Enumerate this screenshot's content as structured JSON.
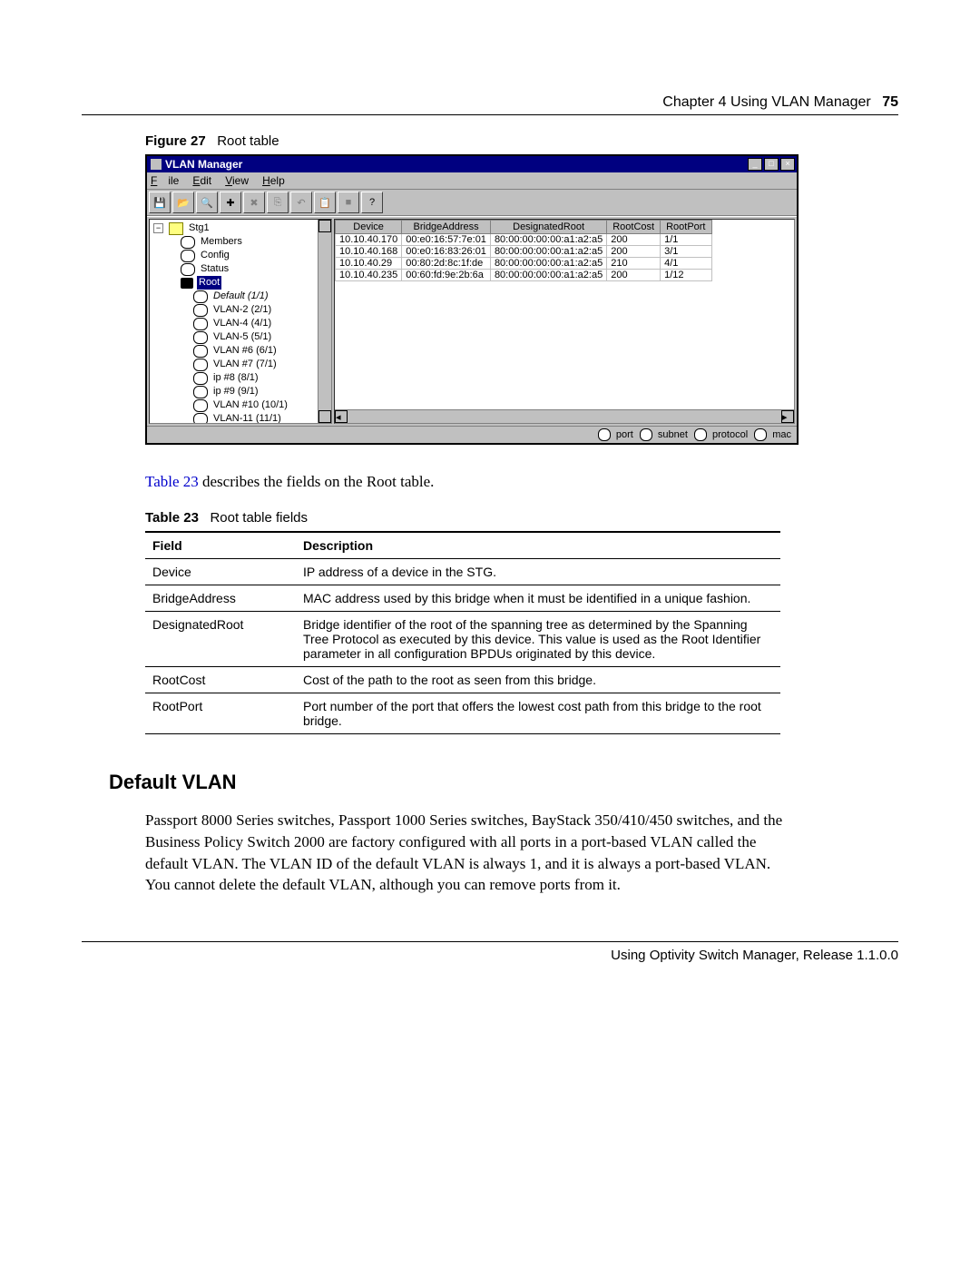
{
  "header": {
    "chapterText": "Chapter 4  Using VLAN Manager",
    "pageNumber": "75"
  },
  "figureCaption": {
    "label": "Figure 27",
    "title": "Root table"
  },
  "window": {
    "title": "VLAN Manager",
    "menus": {
      "file": "File",
      "edit": "Edit",
      "view": "View",
      "help": "Help"
    },
    "toolbarIcons": [
      "save",
      "print",
      "zoom",
      "add",
      "delete",
      "copy",
      "undo",
      "paste",
      "stop",
      "help"
    ],
    "tree": {
      "root": "Stg1",
      "nodes": [
        {
          "label": "Members",
          "glyph": "node",
          "indent": 30
        },
        {
          "label": "Config",
          "glyph": "node",
          "indent": 30
        },
        {
          "label": "Status",
          "glyph": "node",
          "indent": 30
        },
        {
          "label": "Root",
          "glyph": "root",
          "indent": 30,
          "selected": true
        },
        {
          "label": "Default (1/1)",
          "glyph": "node",
          "indent": 44,
          "italic": true
        },
        {
          "label": "VLAN-2 (2/1)",
          "glyph": "node",
          "indent": 44
        },
        {
          "label": "VLAN-4 (4/1)",
          "glyph": "node",
          "indent": 44
        },
        {
          "label": "VLAN-5 (5/1)",
          "glyph": "node",
          "indent": 44
        },
        {
          "label": "VLAN #6 (6/1)",
          "glyph": "node",
          "indent": 44
        },
        {
          "label": "VLAN #7 (7/1)",
          "glyph": "node",
          "indent": 44
        },
        {
          "label": "ip #8 (8/1)",
          "glyph": "node",
          "indent": 44
        },
        {
          "label": "ip #9 (9/1)",
          "glyph": "node",
          "indent": 44
        },
        {
          "label": "VLAN #10 (10/1)",
          "glyph": "node",
          "indent": 44
        },
        {
          "label": "VLAN-11 (11/1)",
          "glyph": "node",
          "indent": 44
        }
      ]
    },
    "columns": [
      "Device",
      "BridgeAddress",
      "DesignatedRoot",
      "RootCost",
      "RootPort"
    ],
    "rows": [
      [
        "10.10.40.170",
        "00:e0:16:57:7e:01",
        "80:00:00:00:00:a1:a2:a5",
        "200",
        "1/1"
      ],
      [
        "10.10.40.168",
        "00:e0:16:83:26:01",
        "80:00:00:00:00:a1:a2:a5",
        "200",
        "3/1"
      ],
      [
        "10.10.40.29",
        "00:80:2d:8c:1f:de",
        "80:00:00:00:00:a1:a2:a5",
        "210",
        "4/1"
      ],
      [
        "10.10.40.235",
        "00:60:fd:9e:2b:6a",
        "80:00:00:00:00:a1:a2:a5",
        "200",
        "1/12"
      ]
    ],
    "status": {
      "port": "port",
      "subnet": "subnet",
      "protocol": "protocol",
      "mac": "mac"
    }
  },
  "descLead": {
    "link": "Table 23",
    "rest": " describes the fields on the Root table."
  },
  "tableCaption": {
    "label": "Table 23",
    "title": "Root table fields"
  },
  "descTable": {
    "headers": {
      "field": "Field",
      "desc": "Description"
    },
    "rows": [
      {
        "field": "Device",
        "desc": "IP address of a device in the STG."
      },
      {
        "field": "BridgeAddress",
        "desc": "MAC address used by this bridge when it must be identified in a unique fashion."
      },
      {
        "field": "DesignatedRoot",
        "desc": "Bridge identifier of the root of the spanning tree as determined by the Spanning Tree Protocol as executed by this device. This value is used as the Root Identifier parameter in all configuration BPDUs originated by this device."
      },
      {
        "field": "RootCost",
        "desc": "Cost of the path to the root as seen from this bridge."
      },
      {
        "field": "RootPort",
        "desc": "Port number of the port that offers the lowest cost path from this bridge to the root bridge."
      }
    ]
  },
  "sectionHeading": "Default VLAN",
  "sectionBody": "Passport 8000 Series switches, Passport 1000 Series switches, BayStack 350/410/450 switches, and the Business Policy Switch 2000 are factory configured with all ports in a port-based VLAN called the default VLAN. The VLAN ID of the default VLAN is always 1, and it is always a port-based VLAN. You cannot delete the default VLAN, although you can remove ports from it.",
  "footer": "Using Optivity Switch Manager, Release 1.1.0.0"
}
